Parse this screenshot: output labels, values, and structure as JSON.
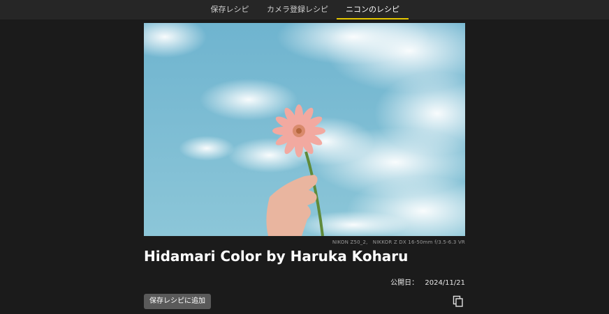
{
  "tabs": [
    {
      "label": "保存レシピ",
      "active": false
    },
    {
      "label": "カメラ登録レシピ",
      "active": false
    },
    {
      "label": "ニコンのレシピ",
      "active": true
    }
  ],
  "recipe": {
    "camera_info": "NIKON Z50_2,　NIKKOR Z DX 16-50mm f/3.5-6.3 VR",
    "title": "Hidamari Color by Haruka Koharu",
    "published_label": "公開日：",
    "published_date": "2024/11/21",
    "add_button_label": "保存レシピに追加"
  },
  "icons": {
    "copy": "copy-icon"
  },
  "colors": {
    "accent_underline": "#e6c800",
    "background": "#1b1b1b",
    "tabbar": "#262626",
    "button": "#5a5a5a"
  }
}
